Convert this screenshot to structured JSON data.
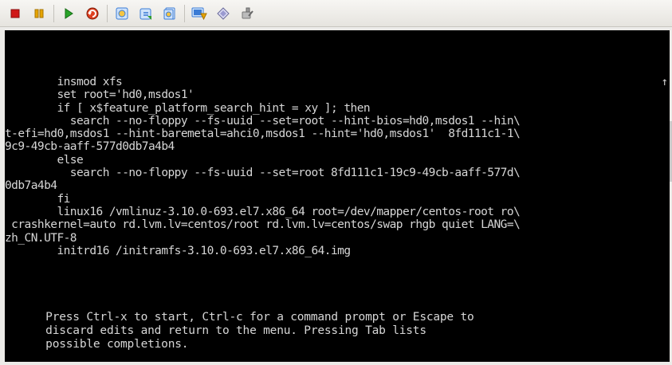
{
  "toolbar": {
    "buttons": [
      {
        "name": "stop-icon",
        "color": "#d01818"
      },
      {
        "name": "pause-icon",
        "color": "#e6a400"
      },
      {
        "name": "play-icon",
        "color": "#29a329"
      },
      {
        "name": "reset-icon",
        "color": "#cc3311"
      },
      {
        "name": "snapshot-icon",
        "color": "#3a7bd5"
      },
      {
        "name": "revert-snapshot-icon",
        "color": "#3a7bd5"
      },
      {
        "name": "snapshot-manager-icon",
        "color": "#3a7bd5"
      },
      {
        "name": "console-view-icon",
        "color": "#3a7bd5"
      },
      {
        "name": "settings-icon",
        "color": "#7a7a9a"
      },
      {
        "name": "tools-icon",
        "color": "#888888"
      }
    ]
  },
  "console": {
    "scroll_up_indicator": "↑",
    "lines": [
      "        insmod xfs",
      "        set root='hd0,msdos1'",
      "        if [ x$feature_platform_search_hint = xy ]; then",
      "          search --no-floppy --fs-uuid --set=root --hint-bios=hd0,msdos1 --hin\\",
      "t-efi=hd0,msdos1 --hint-baremetal=ahci0,msdos1 --hint='hd0,msdos1'  8fd111c1-1\\",
      "9c9-49cb-aaff-577d0db7a4b4",
      "        else",
      "          search --no-floppy --fs-uuid --set=root 8fd111c1-19c9-49cb-aaff-577d\\",
      "0db7a4b4",
      "        fi",
      "        linux16 /vmlinuz-3.10.0-693.el7.x86_64 root=/dev/mapper/centos-root ro\\",
      " crashkernel=auto rd.lvm.lv=centos/root rd.lvm.lv=centos/swap rhgb quiet LANG=\\",
      "zh_CN.UTF-8",
      "        initrd16 /initramfs-3.10.0-693.el7.x86_64.img"
    ],
    "help_lines": [
      "      Press Ctrl-x to start, Ctrl-c for a command prompt or Escape to",
      "      discard edits and return to the menu. Pressing Tab lists",
      "      possible completions."
    ]
  }
}
